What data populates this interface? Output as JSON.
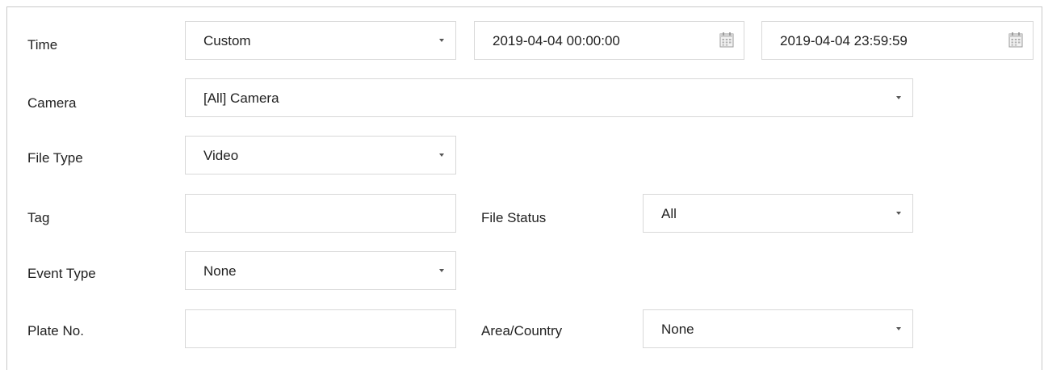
{
  "time": {
    "label": "Time",
    "mode": "Custom",
    "start": "2019-04-04 00:00:00",
    "end": "2019-04-04 23:59:59"
  },
  "camera": {
    "label": "Camera",
    "value": "[All] Camera"
  },
  "file_type": {
    "label": "File Type",
    "value": "Video"
  },
  "tag": {
    "label": "Tag",
    "value": ""
  },
  "file_status": {
    "label": "File Status",
    "value": "All"
  },
  "event_type": {
    "label": "Event Type",
    "value": "None"
  },
  "plate_no": {
    "label": "Plate No.",
    "value": ""
  },
  "area_country": {
    "label": "Area/Country",
    "value": "None"
  },
  "icons": {
    "dropdown": "chevron-down-icon",
    "calendar": "calendar-icon"
  }
}
